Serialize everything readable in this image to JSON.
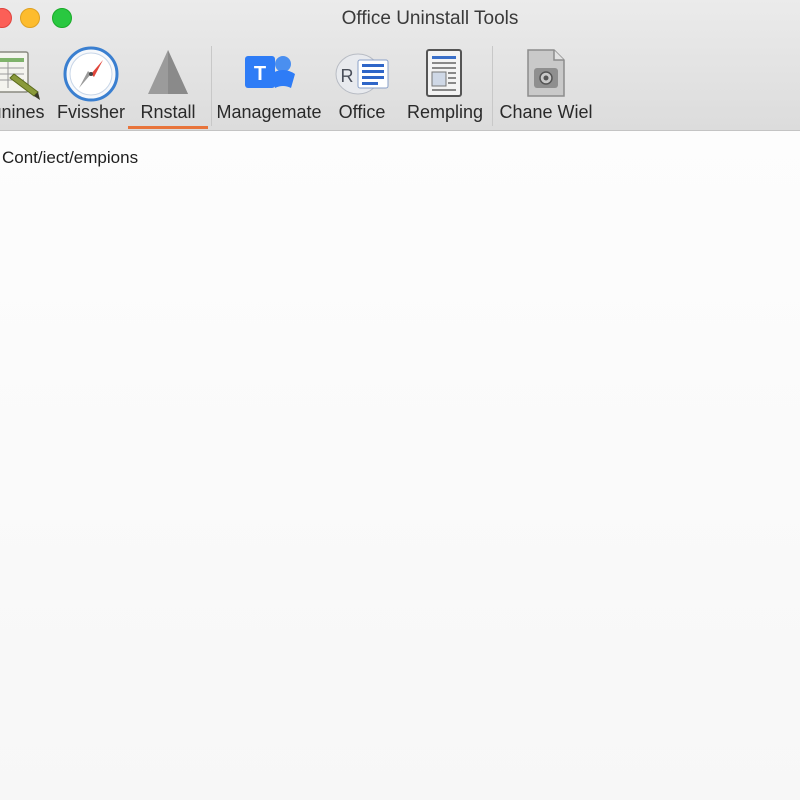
{
  "window": {
    "title": "Office Uninstall Tools"
  },
  "toolbar": {
    "items": [
      {
        "label": "unines",
        "icon": "spreadsheet-pencil-icon"
      },
      {
        "label": "Fvissher",
        "icon": "compass-icon"
      },
      {
        "label": "Rnstall",
        "icon": "triangle-icon",
        "selected": true
      },
      {
        "label": "Managemate",
        "icon": "teams-icon"
      },
      {
        "label": "Office",
        "icon": "office-document-icon"
      },
      {
        "label": "Rempling",
        "icon": "document-pages-icon"
      },
      {
        "label": "Chane Wiel",
        "icon": "file-gear-icon"
      }
    ]
  },
  "main": {
    "section_title": "Cont/iect/empions"
  },
  "colors": {
    "selected_indicator": "#e8743b",
    "teams_blue": "#2e7cf6"
  }
}
